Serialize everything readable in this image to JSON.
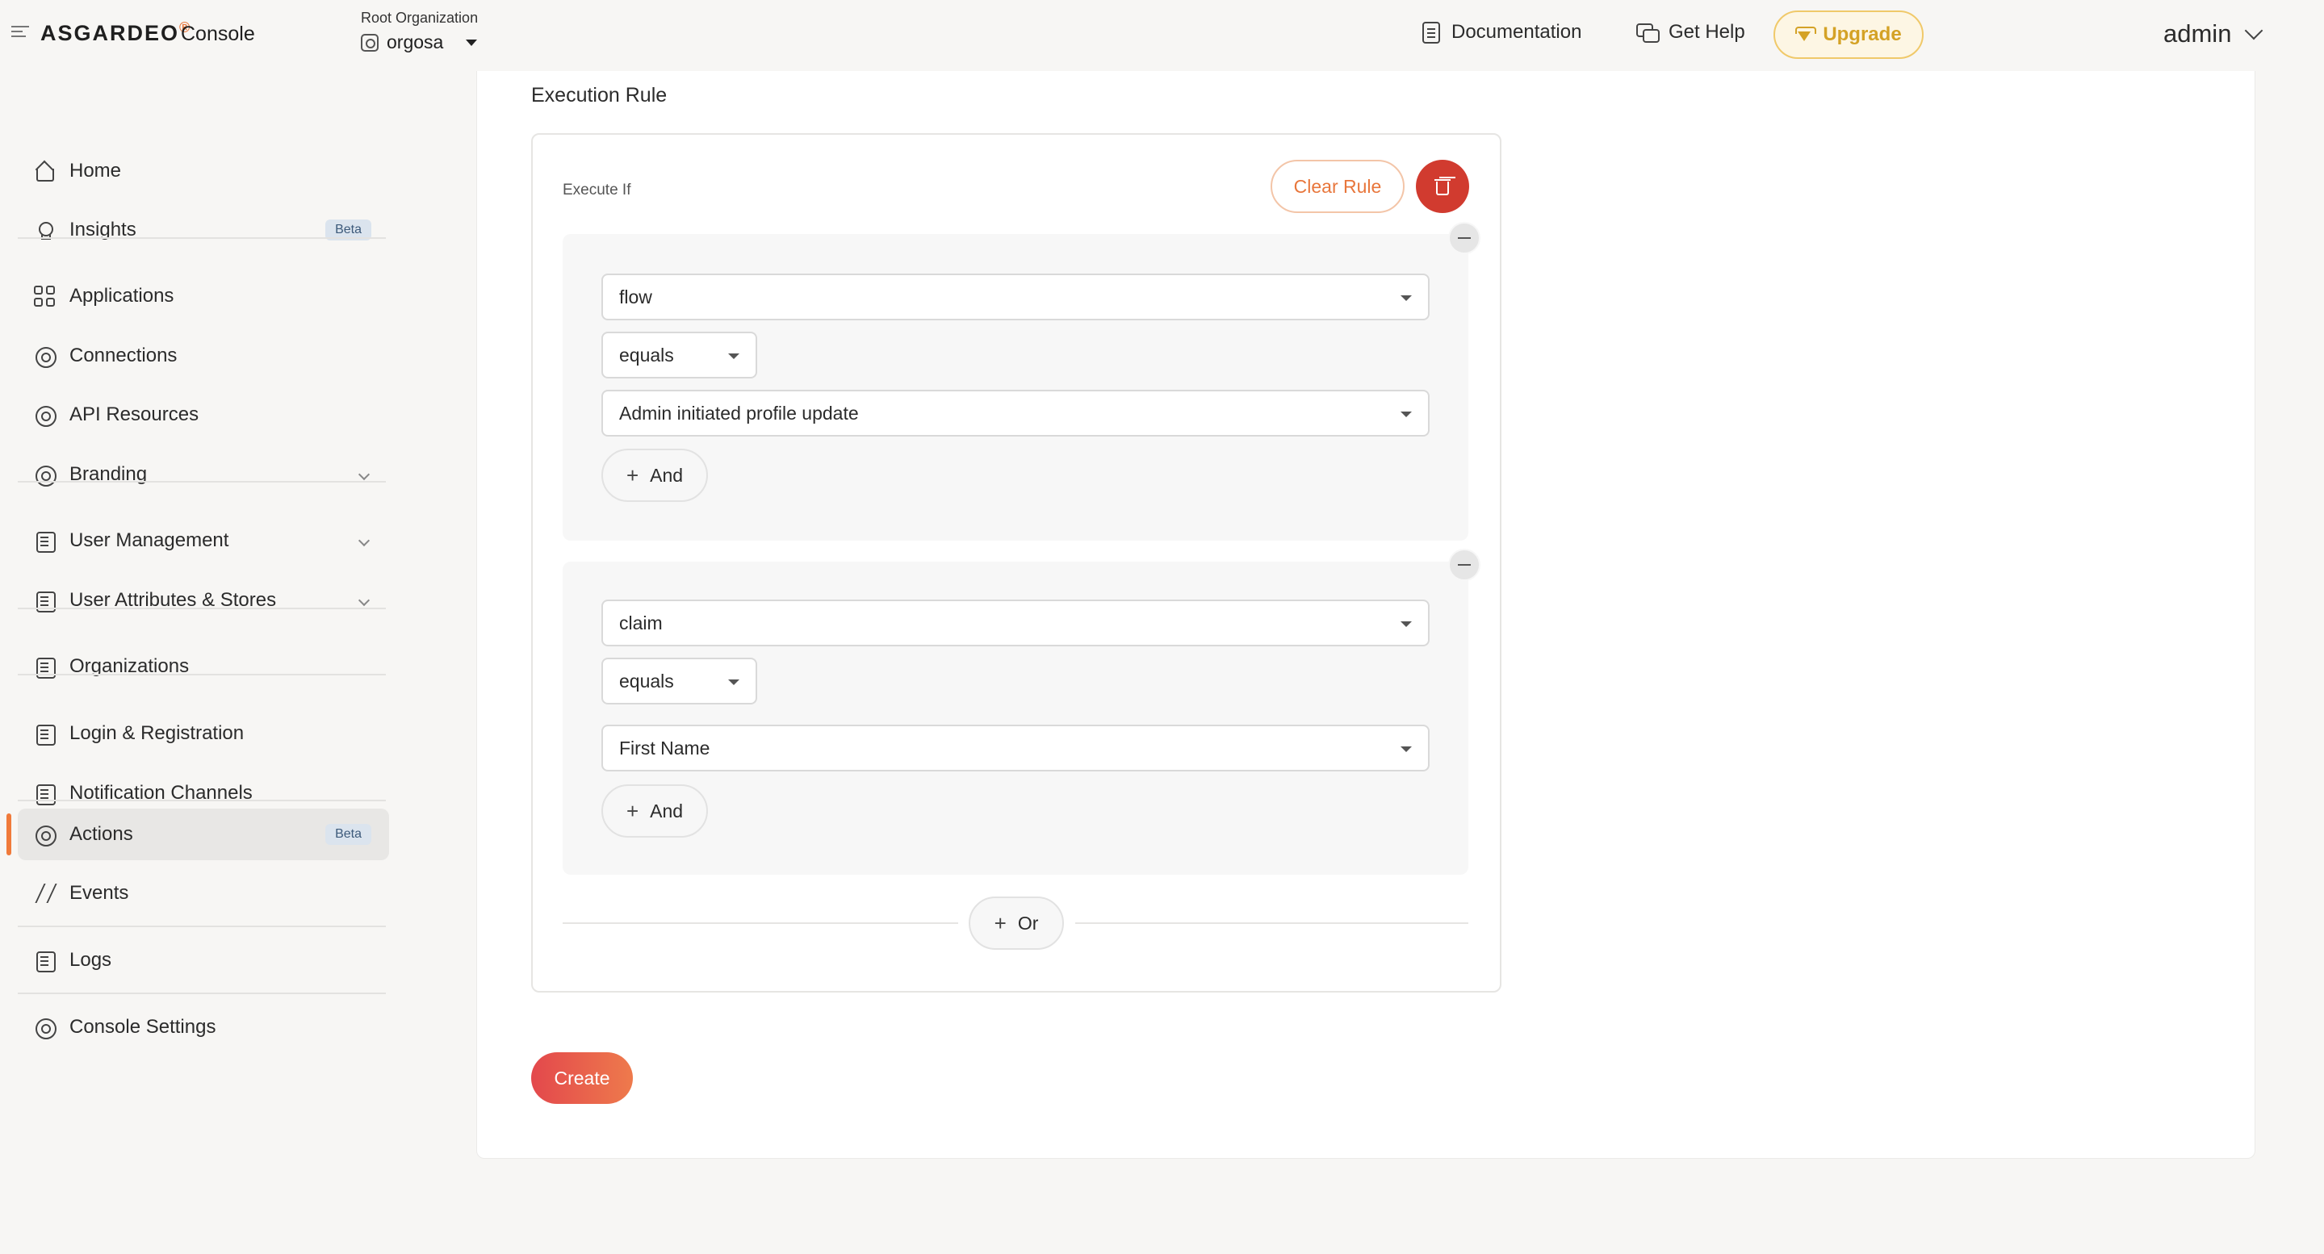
{
  "header": {
    "logo": "ASGARDEO",
    "logo_mark": "®",
    "console": "Console",
    "org_caption": "Root Organization",
    "org_name": "orgosa",
    "documentation": "Documentation",
    "get_help": "Get Help",
    "upgrade": "Upgrade",
    "user": "admin"
  },
  "sidebar": {
    "items": [
      {
        "label": "Home"
      },
      {
        "label": "Insights",
        "badge": "Beta"
      },
      {
        "label": "Applications"
      },
      {
        "label": "Connections"
      },
      {
        "label": "API Resources"
      },
      {
        "label": "Branding"
      },
      {
        "label": "User Management"
      },
      {
        "label": "User Attributes & Stores"
      },
      {
        "label": "Organizations"
      },
      {
        "label": "Login & Registration"
      },
      {
        "label": "Notification Channels"
      },
      {
        "label": "Actions",
        "badge": "Beta",
        "active": true
      },
      {
        "label": "Events"
      },
      {
        "label": "Logs"
      },
      {
        "label": "Console Settings"
      }
    ]
  },
  "main": {
    "section_title": "Execution Rule",
    "execute_if": "Execute If",
    "clear_rule": "Clear Rule",
    "groups": [
      {
        "field": "flow",
        "operator": "equals",
        "value": "Admin initiated profile update",
        "and_label": "And"
      },
      {
        "field": "claim",
        "operator": "equals",
        "value": "First Name",
        "and_label": "And"
      }
    ],
    "or_label": "Or",
    "create": "Create"
  },
  "colors": {
    "accent": "#f07a3a",
    "upgrade": "#d4a226",
    "delete": "#d13b2f",
    "create_start": "#e3484c",
    "create_end": "#ee7a4c"
  }
}
